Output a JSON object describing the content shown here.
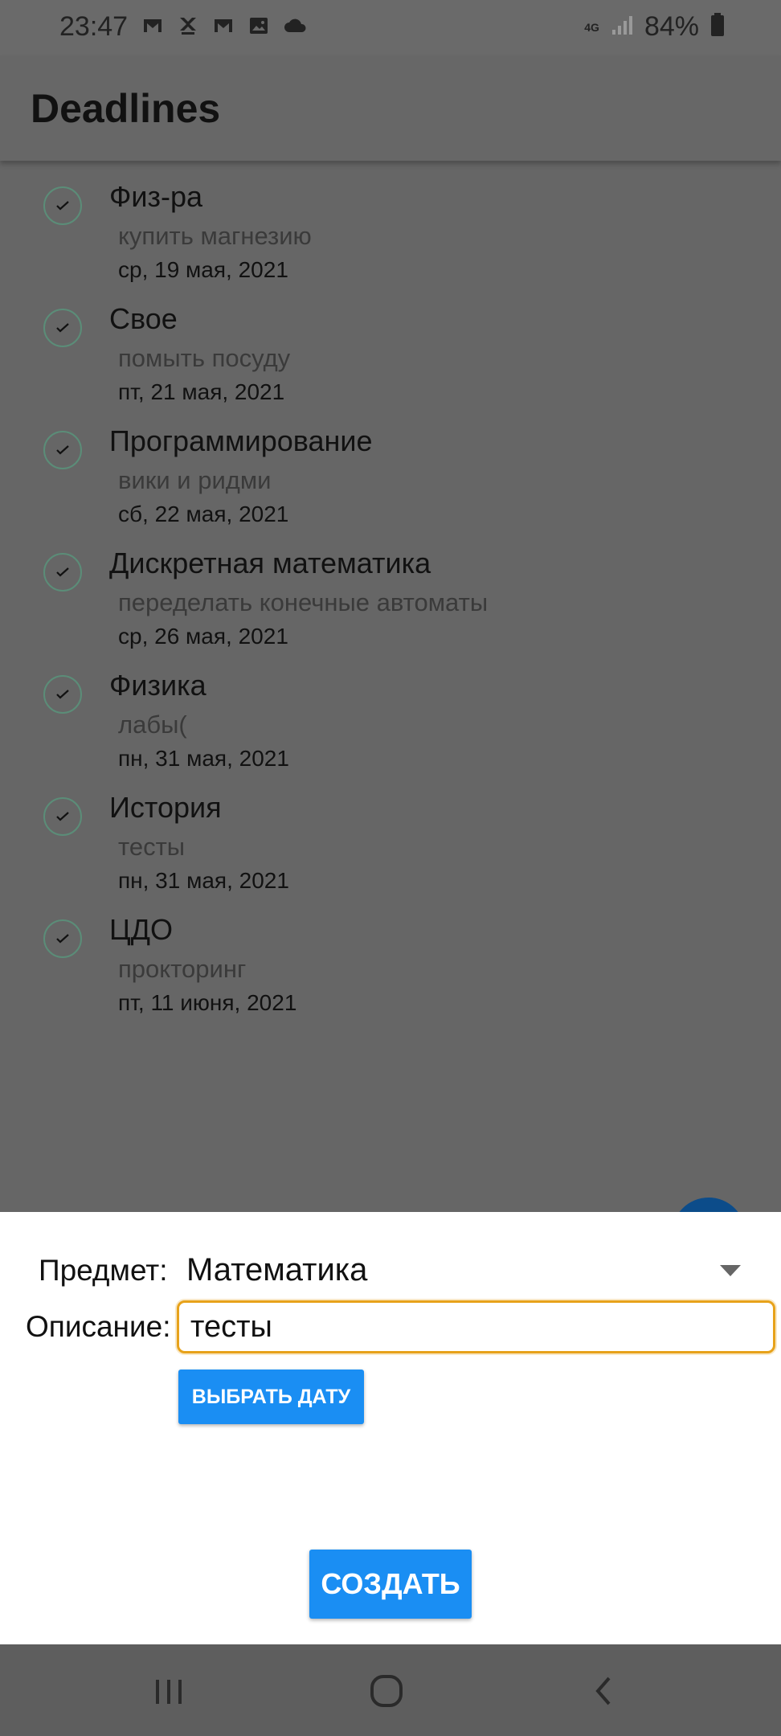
{
  "status_bar": {
    "time": "23:47",
    "network_type": "4G",
    "battery_text": "84%",
    "left_icons": [
      "gmail-icon",
      "app-icon",
      "gmail-icon",
      "gallery-icon",
      "cloud-icon"
    ]
  },
  "app_bar": {
    "title": "Deadlines"
  },
  "deadlines": [
    {
      "subject": "Физ-ра",
      "description": "купить магнезию",
      "date": "ср, 19 мая, 2021"
    },
    {
      "subject": "Свое",
      "description": "помыть посуду",
      "date": "пт, 21 мая, 2021"
    },
    {
      "subject": "Программирование",
      "description": "вики и ридми",
      "date": "сб, 22 мая, 2021"
    },
    {
      "subject": "Дискретная математика",
      "description": "переделать конечные автоматы",
      "date": "ср, 26 мая, 2021"
    },
    {
      "subject": "Физика",
      "description": "лабы(",
      "date": "пн, 31 мая, 2021"
    },
    {
      "subject": "История",
      "description": "тесты",
      "date": "пн, 31 мая, 2021"
    },
    {
      "subject": "ЦДО",
      "description": "прокторинг",
      "date": "пт, 11 июня, 2021"
    }
  ],
  "form": {
    "subject_label": "Предмет:",
    "subject_value": "Математика",
    "description_label": "Описание:",
    "description_value": "тесты",
    "pick_date_label": "ВЫБРАТЬ ДАТУ",
    "create_label": "СОЗДАТЬ"
  },
  "colors": {
    "accent": "#1a8ef3",
    "focus_border": "#e7a21a",
    "scrim": "#666666",
    "check_border": "#5b8d78",
    "fab": "#0c4c8a"
  }
}
